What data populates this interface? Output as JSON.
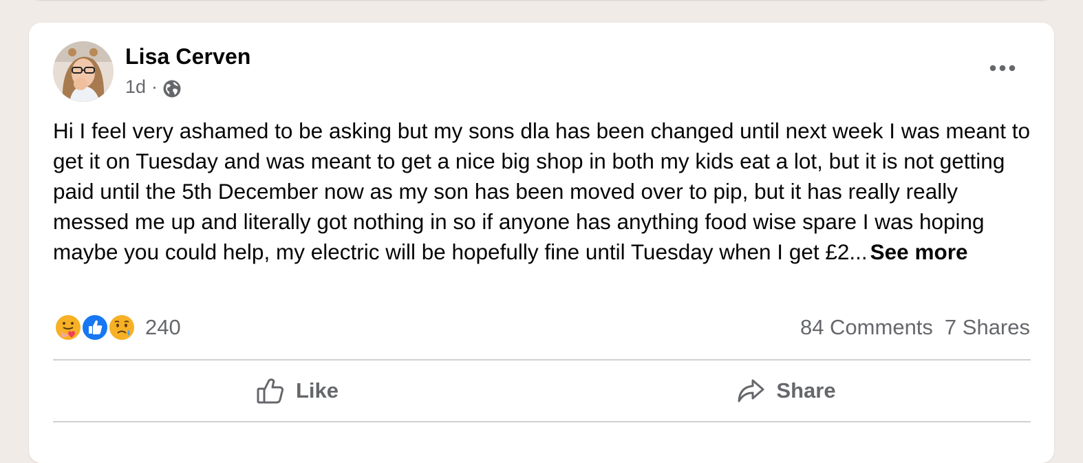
{
  "post": {
    "author": "Lisa Cerven",
    "timestamp": "1d",
    "separator": "·",
    "privacy_icon": "globe-icon",
    "more_icon": "more-options-icon",
    "text": "Hi I feel very ashamed to be asking but my sons dla has been changed until next week I was meant to get it on Tuesday and was meant to get a nice big shop in both my kids eat a lot, but it is not getting paid until the 5th December now as my son has been moved over to pip, but it has really really messed me up and literally got nothing in so if anyone has anything food wise spare I was hoping maybe you could help, my electric will be hopefully fine until Tuesday when I get £2...",
    "see_more": "See more"
  },
  "stats": {
    "reactions": [
      "care",
      "like",
      "sad"
    ],
    "reaction_count": "240",
    "comments": "84 Comments",
    "shares": "7 Shares"
  },
  "actions": {
    "like_label": "Like",
    "share_label": "Share"
  },
  "colors": {
    "background": "#f1ebe7",
    "card": "#ffffff",
    "secondary_text": "#65676b",
    "like_blue": "#1877f2",
    "emoji_yellow": "#f7b125"
  }
}
